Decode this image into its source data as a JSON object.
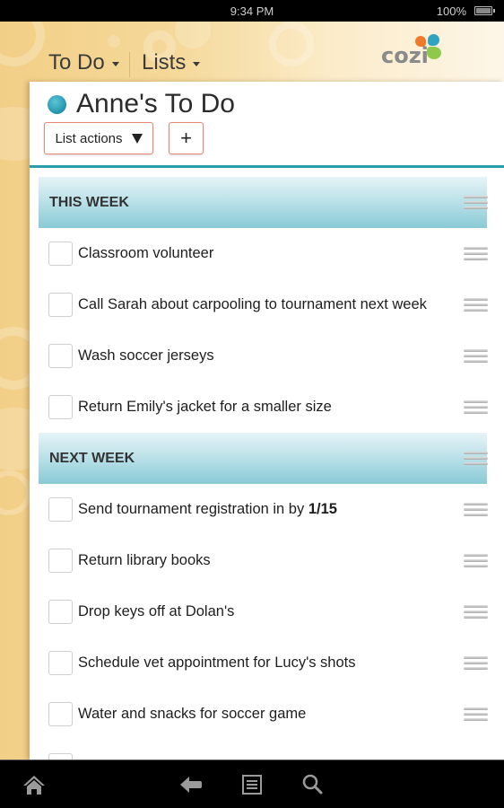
{
  "status_bar": {
    "time": "9:34 PM",
    "battery_percent": "100%",
    "battery_icon": "battery-full-icon"
  },
  "header": {
    "nav_menus": [
      {
        "label": "To Do",
        "icon": "chevron-down-icon"
      },
      {
        "label": "Lists",
        "icon": "chevron-down-icon"
      }
    ],
    "logo_text": "cozi"
  },
  "list": {
    "title": "Anne's To Do",
    "color": "#2fa3c0",
    "actions_label": "List actions",
    "add_label": "+"
  },
  "sections": [
    {
      "title": "THIS WEEK",
      "items": [
        {
          "text": "Classroom volunteer",
          "bold": "",
          "checked": false
        },
        {
          "text": "Call Sarah about carpooling to tournament next week",
          "bold": "",
          "checked": false
        },
        {
          "text": "Wash soccer jerseys",
          "bold": "",
          "checked": false
        },
        {
          "text": "Return Emily's jacket for a smaller size",
          "bold": "",
          "checked": false
        }
      ]
    },
    {
      "title": "NEXT WEEK",
      "items": [
        {
          "text": "Send tournament registration in by ",
          "bold": "1/15",
          "checked": false
        },
        {
          "text": "Return library books",
          "bold": "",
          "checked": false
        },
        {
          "text": "Drop keys off at Dolan's",
          "bold": "",
          "checked": false
        },
        {
          "text": "Schedule vet appointment for Lucy's shots",
          "bold": "",
          "checked": false
        },
        {
          "text": "Water and snacks for soccer game",
          "bold": "",
          "checked": false
        }
      ]
    }
  ],
  "nav_bar": {
    "buttons": [
      "home-icon",
      "back-icon",
      "menu-icon",
      "search-icon"
    ]
  },
  "colors": {
    "accent_teal": "#2a9dad",
    "button_border": "#ea8676",
    "header_bg": "#f5d99a"
  }
}
